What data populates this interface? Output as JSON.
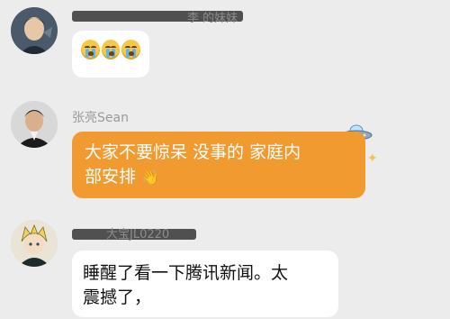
{
  "messages": [
    {
      "sender_redacted": "李 的妹妹",
      "content_type": "emoji",
      "emoji": [
        "crying-face",
        "crying-face",
        "crying-face"
      ]
    },
    {
      "sender": "张亮Sean",
      "content_type": "text",
      "text": "大家不要惊呆 没事的 家庭内\n部安排",
      "trailing_emoji": "waving-hand",
      "bubble_color": "#f19a2f",
      "decorations": [
        "ufo",
        "sparkle"
      ]
    },
    {
      "sender_redacted": "大宝JL0220",
      "content_type": "text",
      "text": "睡醒了看一下腾讯新闻。太\n震撼了，",
      "bubble_color": "#ffffff"
    }
  ]
}
